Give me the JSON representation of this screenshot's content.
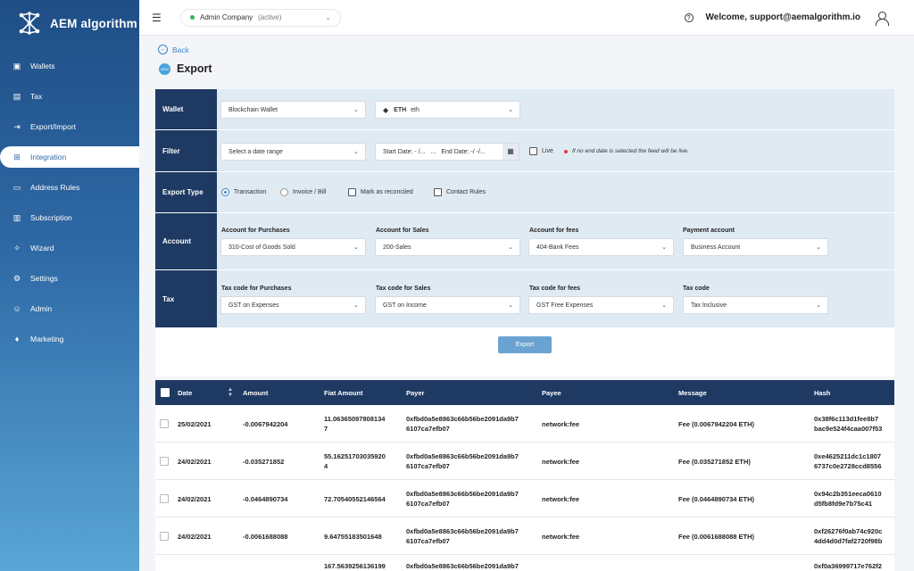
{
  "app": {
    "name": "AEM algorithm"
  },
  "sidebar": {
    "items": [
      {
        "label": "Wallets",
        "icon": "wallet-icon"
      },
      {
        "label": "Tax",
        "icon": "receipt-icon"
      },
      {
        "label": "Export/Import",
        "icon": "export-icon"
      },
      {
        "label": "Integration",
        "icon": "grid-icon",
        "active": true
      },
      {
        "label": "Address Rules",
        "icon": "address-icon"
      },
      {
        "label": "Subscription",
        "icon": "card-icon"
      },
      {
        "label": "Wizard",
        "icon": "wand-icon"
      },
      {
        "label": "Settings",
        "icon": "gear-icon"
      },
      {
        "label": "Admin",
        "icon": "admin-icon"
      },
      {
        "label": "Marketing",
        "icon": "diamond-icon"
      }
    ]
  },
  "topbar": {
    "company": "Admin Company",
    "company_status": "(active)",
    "welcome": "Welcome, support@aemalgorithm.io"
  },
  "page": {
    "back_label": "Back",
    "title": "Export",
    "badge": "AEM"
  },
  "form": {
    "wallet": {
      "label": "Wallet",
      "wallet_select": "Blockchain Wallet",
      "coin_symbol": "ETH",
      "coin_name": "eth"
    },
    "filter": {
      "label": "Filter",
      "date_range": "Select a date range",
      "start_date": "Start Date: - /...",
      "sep": "...",
      "end_date": "End Date: -/ -/...",
      "live_label": "Live",
      "live_note": "If no end date is selected the feed will be live."
    },
    "export_type": {
      "label": "Export Type",
      "options": [
        "Transaction",
        "Invoice / Bill"
      ],
      "mark_reconciled": "Mark as reconciled",
      "contact_rules": "Contact Rules"
    },
    "account": {
      "label": "Account",
      "fields": [
        {
          "label": "Account for Purchases",
          "value": "310-Cost of Goods Sold"
        },
        {
          "label": "Account for Sales",
          "value": "200-Sales"
        },
        {
          "label": "Account for fees",
          "value": "404-Bank Fees"
        },
        {
          "label": "Payment account",
          "value": "Business Account"
        }
      ]
    },
    "tax": {
      "label": "Tax",
      "fields": [
        {
          "label": "Tax code for Purchases",
          "value": "GST on Expenses"
        },
        {
          "label": "Tax code for Sales",
          "value": "GST on Income"
        },
        {
          "label": "Tax code for fees",
          "value": "GST Free Expenses"
        },
        {
          "label": "Tax code",
          "value": "Tax Inclusive"
        }
      ]
    },
    "export_button": "Export"
  },
  "table": {
    "columns": [
      "Date",
      "Amount",
      "Fiat Amount",
      "Payer",
      "Payee",
      "Message",
      "Hash"
    ],
    "rows": [
      {
        "date": "25/02/2021",
        "amount": "-0.0067942204",
        "fiat1": "11.06365097808134",
        "fiat2": "7",
        "payer1": "0xfbd0a5e8863c66b56be2091da9b7",
        "payer2": "6107ca7efb07",
        "payee": "network:fee",
        "message": "Fee (0.0067942204 ETH)",
        "hash1": "0x38f6c113d1fee8b7",
        "hash2": "bac9e524f4caa007f53"
      },
      {
        "date": "24/02/2021",
        "amount": "-0.035271852",
        "fiat1": "55.16251703035920",
        "fiat2": "4",
        "payer1": "0xfbd0a5e8863c66b56be2091da9b7",
        "payer2": "6107ca7efb07",
        "payee": "network:fee",
        "message": "Fee (0.035271852 ETH)",
        "hash1": "0xe4625211dc1c1807",
        "hash2": "6737c0e2728ccd8556"
      },
      {
        "date": "24/02/2021",
        "amount": "-0.0464890734",
        "fiat1": "72.70540552146564",
        "fiat2": "",
        "payer1": "0xfbd0a5e8863c66b56be2091da9b7",
        "payer2": "6107ca7efb07",
        "payee": "network:fee",
        "message": "Fee (0.0464890734 ETH)",
        "hash1": "0x94c2b351eeca0610",
        "hash2": "d5fb8fd9e7b75c41"
      },
      {
        "date": "24/02/2021",
        "amount": "-0.0061688088",
        "fiat1": "9.64755183501648",
        "fiat2": "",
        "payer1": "0xfbd0a5e8863c66b56be2091da9b7",
        "payer2": "6107ca7efb07",
        "payee": "network:fee",
        "message": "Fee (0.0061688088 ETH)",
        "hash1": "0xf26276f0ab74c920c",
        "hash2": "4dd4d0d7faf2720f98b"
      },
      {
        "date": "",
        "amount": "",
        "fiat1": "167.5639256136199",
        "fiat2": "",
        "payer1": "0xfbd0a5e8863c66b56be2091da9b7",
        "payer2": "",
        "payee": "",
        "message": "",
        "hash1": "0xf0a36999717e762f2",
        "hash2": ""
      }
    ]
  }
}
